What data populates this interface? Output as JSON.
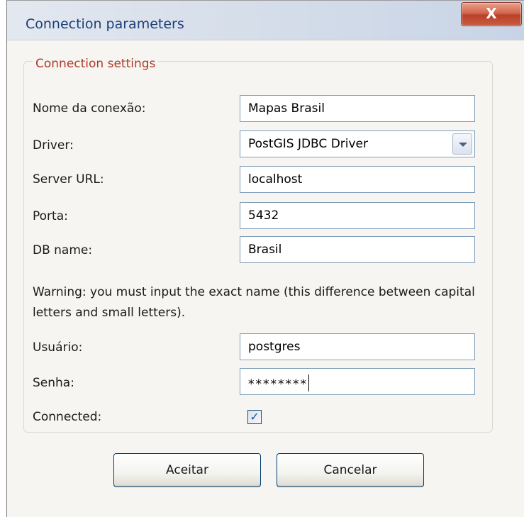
{
  "window": {
    "title": "Connection parameters",
    "close_glyph": "X"
  },
  "group": {
    "legend": "Connection settings"
  },
  "form": {
    "connection_name": {
      "label": "Nome da conexão:",
      "value": "Mapas Brasil"
    },
    "driver": {
      "label": "Driver:",
      "value": "PostGIS JDBC Driver"
    },
    "server_url": {
      "label": "Server URL:",
      "value": "localhost"
    },
    "port": {
      "label": "Porta:",
      "value": "5432"
    },
    "db_name": {
      "label": "DB name:",
      "value": "Brasil"
    },
    "warning": "Warning: you must input the exact name (this difference between capital letters and small letters).",
    "user": {
      "label": "Usuário:",
      "value": "postgres"
    },
    "password": {
      "label": "Senha:",
      "value": "********"
    },
    "connected": {
      "label": "Connected:",
      "checked": true,
      "glyph": "✓"
    }
  },
  "buttons": {
    "accept": "Aceitar",
    "cancel": "Cancelar"
  },
  "colors": {
    "title_text": "#1b3f78",
    "legend_text": "#b03a25",
    "close_button": "#c75d40",
    "field_border": "#7f9db9"
  }
}
